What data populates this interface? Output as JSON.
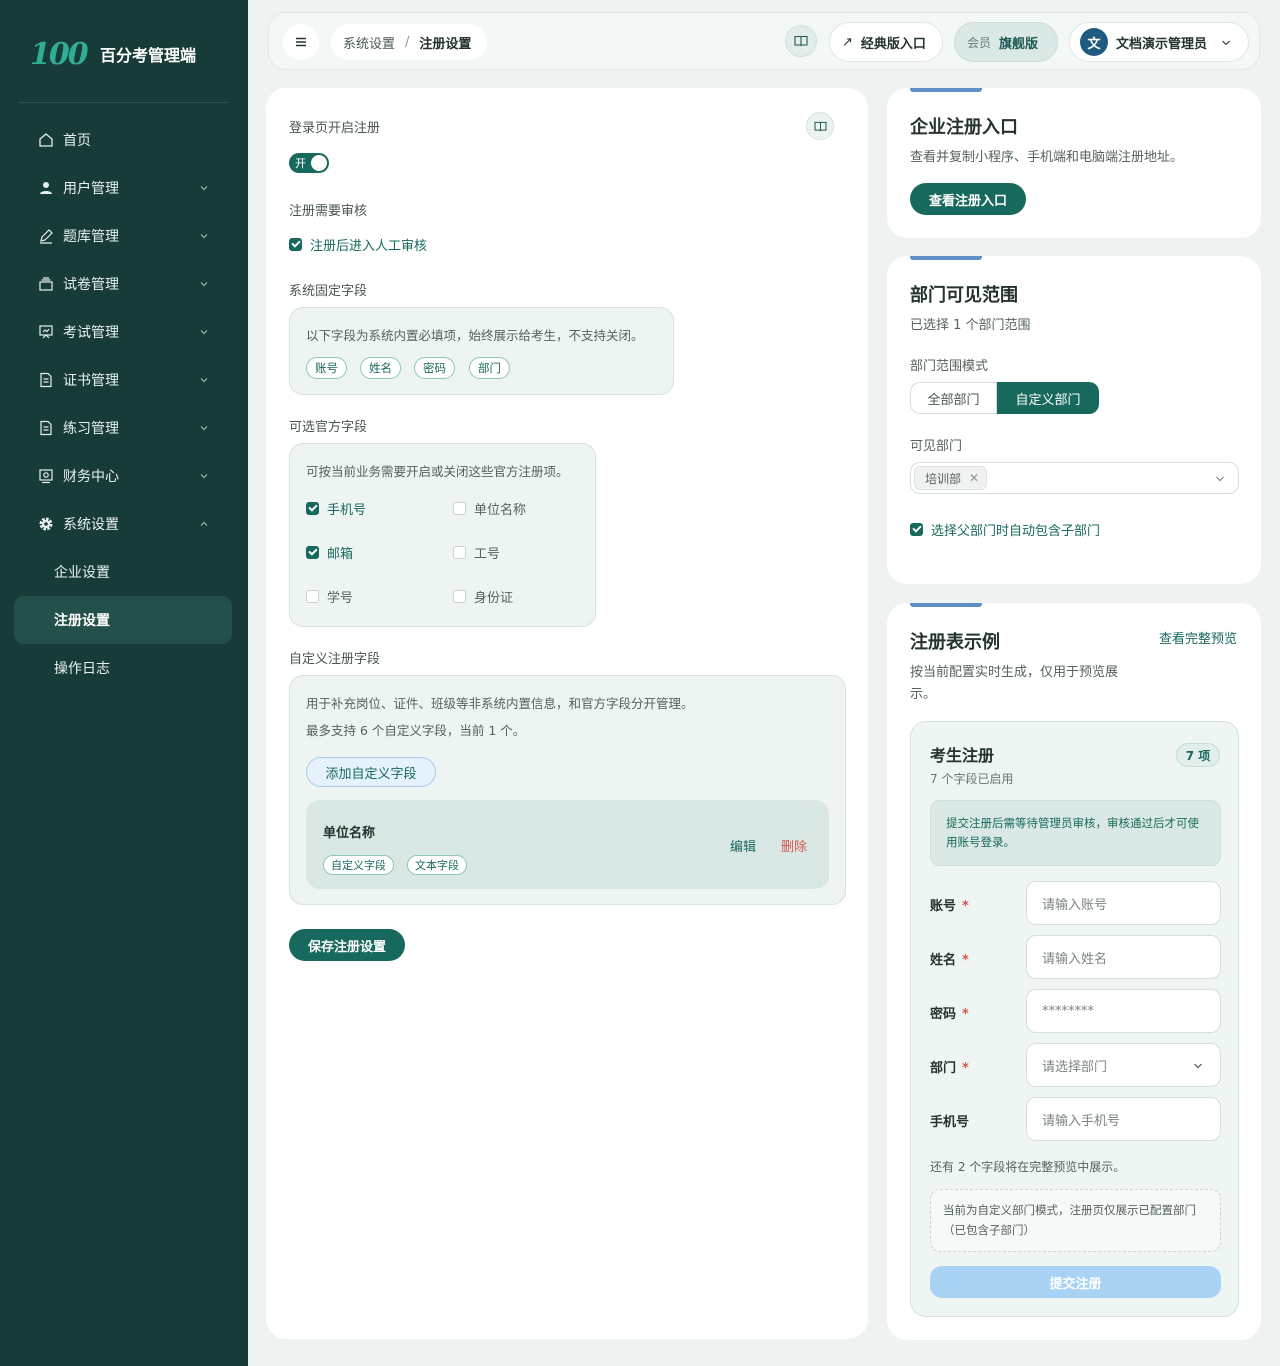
{
  "brand": {
    "logo": "100",
    "name": "百分考管理端"
  },
  "sidebar": {
    "items": [
      {
        "label": "首页",
        "icon": "home-icon"
      },
      {
        "label": "用户管理",
        "icon": "user-icon"
      },
      {
        "label": "题库管理",
        "icon": "pen-icon"
      },
      {
        "label": "试卷管理",
        "icon": "paper-stack-icon"
      },
      {
        "label": "考试管理",
        "icon": "board-icon"
      },
      {
        "label": "证书管理",
        "icon": "document-icon"
      },
      {
        "label": "练习管理",
        "icon": "document-icon"
      },
      {
        "label": "财务中心",
        "icon": "finance-icon"
      },
      {
        "label": "系统设置",
        "icon": "gear-icon"
      }
    ],
    "sub_items": [
      {
        "label": "企业设置"
      },
      {
        "label": "注册设置",
        "active": true
      },
      {
        "label": "操作日志"
      }
    ]
  },
  "topbar": {
    "breadcrumb": [
      "系统设置",
      "注册设置"
    ],
    "breadcrumb_sep": "/",
    "classic_entry": "经典版入口",
    "member_label": "会员",
    "member_level": "旗舰版",
    "avatar_text": "文",
    "user_name": "文档演示管理员"
  },
  "main": {
    "login_register_label": "登录页开启注册",
    "switch_text": "开",
    "review_label": "注册需要审核",
    "review_checkbox": "注册后进入人工审核",
    "fixed_label": "系统固定字段",
    "fixed_desc": "以下字段为系统内置必填项，始终展示给考生，不支持关闭。",
    "fixed_tags": [
      "账号",
      "姓名",
      "密码",
      "部门"
    ],
    "optional_label": "可选官方字段",
    "optional_desc": "可按当前业务需要开启或关闭这些官方注册项。",
    "optional_fields": [
      {
        "label": "手机号",
        "checked": true
      },
      {
        "label": "单位名称",
        "checked": false
      },
      {
        "label": "邮箱",
        "checked": true
      },
      {
        "label": "工号",
        "checked": false
      },
      {
        "label": "学号",
        "checked": false
      },
      {
        "label": "身份证",
        "checked": false
      }
    ],
    "custom_label": "自定义注册字段",
    "custom_desc1": "用于补充岗位、证件、班级等非系统内置信息，和官方字段分开管理。",
    "custom_desc2": "最多支持 6 个自定义字段，当前 1 个。",
    "add_button": "添加自定义字段",
    "custom_field": {
      "name": "单位名称",
      "tags": [
        "自定义字段",
        "文本字段"
      ],
      "edit": "编辑",
      "delete": "删除"
    },
    "save_button": "保存注册设置"
  },
  "entry_card": {
    "title": "企业注册入口",
    "desc": "查看并复制小程序、手机端和电脑端注册地址。",
    "button": "查看注册入口"
  },
  "dept_card": {
    "title": "部门可见范围",
    "desc": "已选择 1 个部门范围",
    "mode_label": "部门范围模式",
    "mode_all": "全部部门",
    "mode_custom": "自定义部门",
    "visible_label": "可见部门",
    "selected_chip": "培训部",
    "include_children": "选择父部门时自动包含子部门"
  },
  "preview_card": {
    "title": "注册表示例",
    "link": "查看完整预览",
    "desc_line1": "按当前配置实时生成，仅用于预览展",
    "desc_line2": "示。",
    "form_title": "考生注册",
    "form_sub": "7 个字段已启用",
    "count_badge": "7 项",
    "notice": "提交注册后需等待管理员审核，审核通过后才可使用账号登录。",
    "fields": [
      {
        "label": "账号",
        "required": "*",
        "placeholder": "请输入账号"
      },
      {
        "label": "姓名",
        "required": "*",
        "placeholder": "请输入姓名"
      },
      {
        "label": "密码",
        "required": "*",
        "placeholder": "********"
      },
      {
        "label": "部门",
        "required": "*",
        "placeholder": "请选择部门"
      },
      {
        "label": "手机号",
        "required": "",
        "placeholder": "请输入手机号"
      }
    ],
    "more_text": "还有 2 个字段将在完整预览中展示。",
    "dept_notice": "当前为自定义部门模式，注册页仅展示已配置部门（已包含子部门）",
    "submit": "提交注册"
  },
  "colors": {
    "sidebar_bg": "#173b38",
    "primary": "#17695d",
    "danger": "#d9534f",
    "submit_disabled": "#a9d3f5",
    "accent_bar": "#5f8fc7"
  }
}
